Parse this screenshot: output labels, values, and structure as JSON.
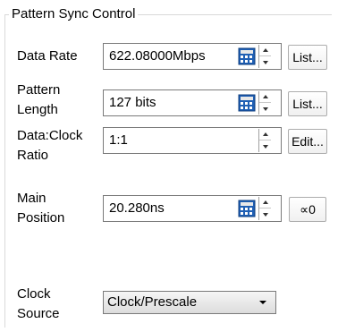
{
  "group": {
    "title": "Pattern Sync Control"
  },
  "rows": [
    {
      "label": "Data Rate",
      "value": "622.08000Mbps",
      "button": "List..."
    },
    {
      "label_lines": [
        "Pattern",
        "Length"
      ],
      "value": "127 bits",
      "button": "List..."
    },
    {
      "label_lines": [
        "Data:Clock",
        "Ratio"
      ],
      "value": "1:1",
      "button": "Edit..."
    },
    {
      "label_lines": [
        "Main",
        "Position"
      ],
      "value": "20.280ns",
      "button": "∝0"
    }
  ],
  "clock_source": {
    "label_lines": [
      "Clock",
      "Source"
    ],
    "value": "Clock/Prescale"
  },
  "colors": {
    "calc_blue": "#1f5fb4",
    "calc_gray": "#8d8d8d"
  },
  "icons": [
    "calculator-icon",
    "spin-up-icon",
    "spin-down-icon",
    "dropdown-arrow-icon"
  ]
}
